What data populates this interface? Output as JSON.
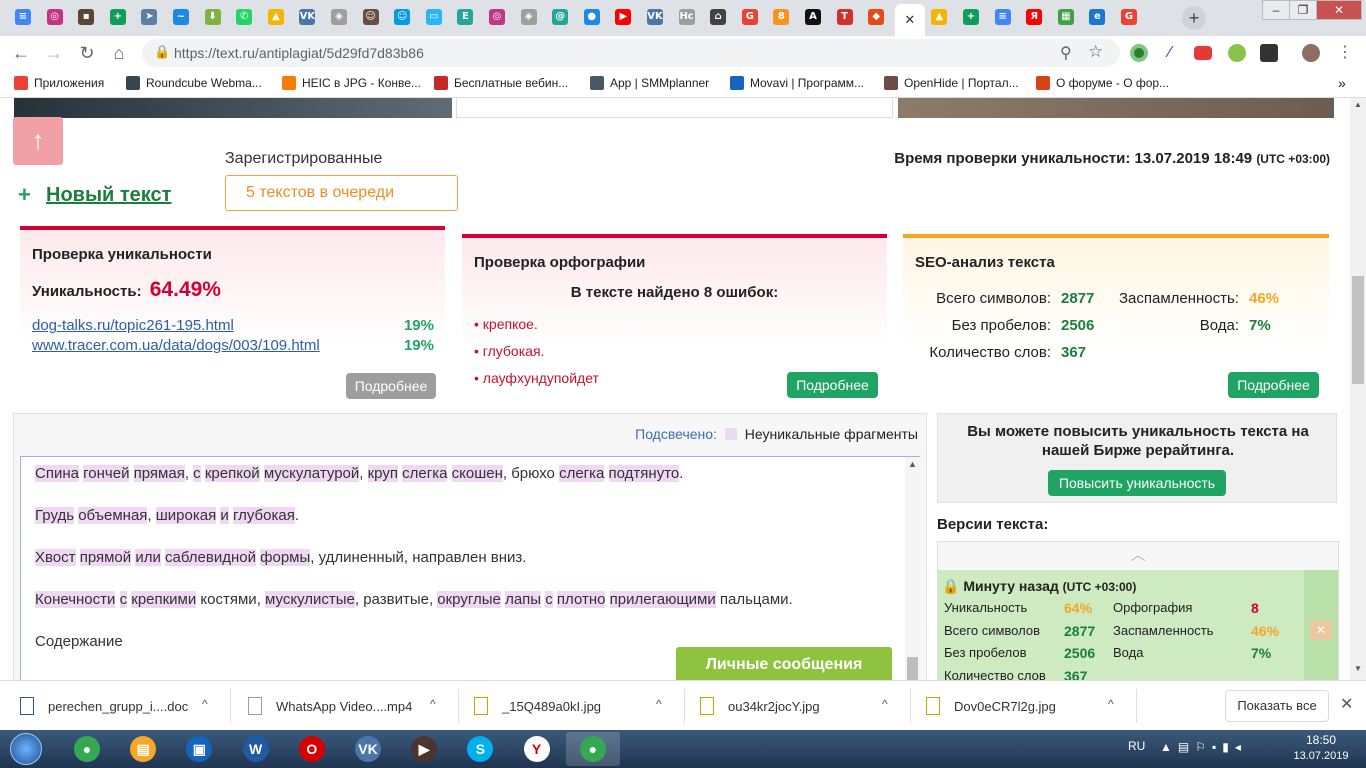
{
  "browser": {
    "tabs": [
      {
        "icon": "docs-icon",
        "color": "#4285f4",
        "glyph": "≡"
      },
      {
        "icon": "instagram-icon",
        "color": "#c13584",
        "glyph": "◎"
      },
      {
        "icon": "photo-icon",
        "color": "#5a4632",
        "glyph": "▪"
      },
      {
        "icon": "sheets-icon",
        "color": "#0f9d58",
        "glyph": "+"
      },
      {
        "icon": "telegram-icon",
        "color": "#5c7fa3",
        "glyph": "➤"
      },
      {
        "icon": "wave-icon",
        "color": "#1e88e5",
        "glyph": "~"
      },
      {
        "icon": "download-icon",
        "color": "#7cb342",
        "glyph": "⬇"
      },
      {
        "icon": "whatsapp-icon",
        "color": "#25d366",
        "glyph": "✆"
      },
      {
        "icon": "drive-icon",
        "color": "#f4b400",
        "glyph": "▲"
      },
      {
        "icon": "vk-icon",
        "color": "#4a76a8",
        "glyph": "VK"
      },
      {
        "icon": "shield-icon",
        "color": "#9e9e9e",
        "glyph": "◈"
      },
      {
        "icon": "avatar-icon",
        "color": "#6d4c41",
        "glyph": "☺"
      },
      {
        "icon": "chat-icon",
        "color": "#039be5",
        "glyph": "☺"
      },
      {
        "icon": "tv-icon",
        "color": "#29b6f6",
        "glyph": "▭"
      },
      {
        "icon": "text-icon",
        "color": "#26a69a",
        "glyph": "E"
      },
      {
        "icon": "instagram-icon",
        "color": "#c13584",
        "glyph": "◎"
      },
      {
        "icon": "shield-icon",
        "color": "#9e9e9e",
        "glyph": "◈"
      },
      {
        "icon": "spiral-icon",
        "color": "#26a69a",
        "glyph": "@"
      },
      {
        "icon": "drop-icon",
        "color": "#1e88e5",
        "glyph": "●"
      },
      {
        "icon": "youtube-icon",
        "color": "#ff0000",
        "glyph": "▶"
      },
      {
        "icon": "vk-icon",
        "color": "#4a76a8",
        "glyph": "VK"
      },
      {
        "icon": "hc-icon",
        "color": "#9e9e9e",
        "glyph": "Hc"
      },
      {
        "icon": "basket-icon",
        "color": "#424242",
        "glyph": "⌂"
      },
      {
        "icon": "google-icon",
        "color": "#ea4335",
        "glyph": "G"
      },
      {
        "icon": "ok-icon",
        "color": "#f7931e",
        "glyph": "8"
      },
      {
        "icon": "a-icon",
        "color": "#111111",
        "glyph": "A"
      },
      {
        "icon": "t-icon",
        "color": "#d32f2f",
        "glyph": "T"
      },
      {
        "icon": "fox-icon",
        "color": "#e64a19",
        "glyph": "◆"
      },
      {
        "icon": "close-icon",
        "color": "#ffffff",
        "glyph": "✕",
        "active": true
      },
      {
        "icon": "drive-icon",
        "color": "#f4b400",
        "glyph": "▲"
      },
      {
        "icon": "sheets-icon",
        "color": "#0f9d58",
        "glyph": "+"
      },
      {
        "icon": "docs-icon",
        "color": "#4285f4",
        "glyph": "≡"
      },
      {
        "icon": "yandex-icon",
        "color": "#ff0000",
        "glyph": "Я"
      },
      {
        "icon": "map-icon",
        "color": "#43a047",
        "glyph": "▦"
      },
      {
        "icon": "edge-icon",
        "color": "#1976d2",
        "glyph": "e"
      },
      {
        "icon": "google-icon",
        "color": "#ea4335",
        "glyph": "G"
      }
    ],
    "url": "https://text.ru/antiplagiat/5d29fd7d83b86",
    "bookmarks": [
      {
        "label": "Приложения",
        "color": "#ea4335"
      },
      {
        "label": "Roundcube Webma...",
        "color": "#37474f"
      },
      {
        "label": "HEIC в JPG - Конве...",
        "color": "#f57c00"
      },
      {
        "label": "Бесплатные вебин...",
        "color": "#c62828"
      },
      {
        "label": "App | SMMplanner",
        "color": "#455a64"
      },
      {
        "label": "Movavi | Программ...",
        "color": "#1565c0"
      },
      {
        "label": "OpenHide | Портал...",
        "color": "#6d4c41"
      },
      {
        "label": "О форуме - О фор...",
        "color": "#d84315"
      }
    ],
    "bookmarks_more": "»"
  },
  "page": {
    "scroll_up_glyph": "↑",
    "registered_label": "Зарегистрированные",
    "queue_label": "5 текстов в очереди",
    "new_text_icon": "+",
    "new_text_label": "Новый текст",
    "check_time_label": "Время проверки уникальности: 13.07.2019 18:49",
    "check_time_tz": "(UTC +03:00)",
    "uniqueness": {
      "title": "Проверка уникальности",
      "label": "Уникальность:",
      "value": "64.49%",
      "sources": [
        {
          "url": "dog-talks.ru/topic261-195.html",
          "percent": "19%"
        },
        {
          "url": "www.tracer.com.ua/data/dogs/003/109.html",
          "percent": "19%"
        }
      ],
      "more_label": "Подробнее",
      "accent": "#d50032"
    },
    "spelling": {
      "title": "Проверка орфографии",
      "subtitle": "В тексте найдено 8 ошибок:",
      "errors": [
        "крепкое.",
        "глубокая.",
        "лауфхундупойдет"
      ],
      "more_label": "Подробнее",
      "accent": "#d50032"
    },
    "seo": {
      "title": "SEO-анализ текста",
      "left": [
        {
          "label": "Всего символов:",
          "value": "2877"
        },
        {
          "label": "Без пробелов:",
          "value": "2506"
        },
        {
          "label": "Количество слов:",
          "value": "367"
        }
      ],
      "right": [
        {
          "label": "Заспамленность:",
          "value": "46%"
        },
        {
          "label": "Вода:",
          "value": "7%"
        }
      ],
      "more_label": "Подробнее",
      "accent": "#f5a623"
    },
    "highlight_label": "Подсвечено:",
    "highlight_legend": "Неуникальные фрагменты",
    "text_paragraphs": [
      [
        [
          "Спина",
          1
        ],
        [
          " ",
          0
        ],
        [
          "гончей",
          1
        ],
        [
          " ",
          0
        ],
        [
          "прямая",
          1
        ],
        [
          ", ",
          0
        ],
        [
          "с",
          1
        ],
        [
          " ",
          0
        ],
        [
          "крепкой",
          1
        ],
        [
          " ",
          0
        ],
        [
          "мускулатурой",
          1
        ],
        [
          ", ",
          0
        ],
        [
          "круп",
          1
        ],
        [
          " ",
          0
        ],
        [
          "слегка",
          1
        ],
        [
          " ",
          0
        ],
        [
          "скошен",
          1
        ],
        [
          ", брюхо ",
          0
        ],
        [
          "слегка",
          1
        ],
        [
          " ",
          0
        ],
        [
          "подтянуто",
          1
        ],
        [
          ".",
          0
        ]
      ],
      [
        [
          "Грудь",
          1
        ],
        [
          " ",
          0
        ],
        [
          "объемная",
          1
        ],
        [
          ", ",
          0
        ],
        [
          "широкая",
          1
        ],
        [
          " ",
          0
        ],
        [
          "и",
          1
        ],
        [
          " ",
          0
        ],
        [
          "глубокая",
          1
        ],
        [
          ".",
          0
        ]
      ],
      [
        [
          "Хвост",
          1
        ],
        [
          " ",
          0
        ],
        [
          "прямой",
          1
        ],
        [
          " ",
          0
        ],
        [
          "или",
          1
        ],
        [
          " ",
          0
        ],
        [
          "саблевидной",
          1
        ],
        [
          " ",
          0
        ],
        [
          "формы",
          1
        ],
        [
          ", удлиненный, направлен вниз.",
          0
        ]
      ],
      [
        [
          "Конечности",
          1
        ],
        [
          " ",
          0
        ],
        [
          "с",
          1
        ],
        [
          " ",
          0
        ],
        [
          "крепкими",
          1
        ],
        [
          " костями, ",
          0
        ],
        [
          "мускулистые",
          1
        ],
        [
          ", развитые, ",
          0
        ],
        [
          "округлые",
          1
        ],
        [
          " ",
          0
        ],
        [
          "лапы",
          1
        ],
        [
          " ",
          0
        ],
        [
          "с",
          1
        ],
        [
          " ",
          0
        ],
        [
          "плотно",
          1
        ],
        [
          " ",
          0
        ],
        [
          "прилегающими",
          1
        ],
        [
          " пальцами.",
          0
        ]
      ],
      [
        [
          "Содержание",
          0
        ]
      ]
    ],
    "messages_label": "Личные сообщения",
    "promo_text": "Вы можете повысить уникальность текста на нашей Бирже рерайтинга.",
    "promo_button": "Повысить уникальность",
    "versions_title": "Версии текста:",
    "version": {
      "time": "Минуту назад",
      "tz": "(UTC +03:00)",
      "rows": [
        {
          "l1": "Уникальность",
          "v1": "64%",
          "l2": "Орфография",
          "v2": "8"
        },
        {
          "l1": "Всего символов",
          "v1": "2877",
          "l2": "Заспамленность",
          "v2": "46%"
        },
        {
          "l1": "Без пробелов",
          "v1": "2506",
          "l2": "Вода",
          "v2": "7%"
        },
        {
          "l1": "Количество слов",
          "v1": "367",
          "l2": "",
          "v2": ""
        }
      ]
    }
  },
  "downloads": {
    "items": [
      {
        "name": "perechen_grupp_i....doc",
        "icon": "word-file-icon"
      },
      {
        "name": "WhatsApp Video....mp4",
        "icon": "video-file-icon"
      },
      {
        "name": "_15Q489a0kI.jpg",
        "icon": "image-file-icon"
      },
      {
        "name": "ou34kr2jocY.jpg",
        "icon": "image-file-icon"
      },
      {
        "name": "Dov0eCR7l2g.jpg",
        "icon": "image-file-icon"
      }
    ],
    "show_all": "Показать все",
    "chevron": "^"
  },
  "taskbar": {
    "apps": [
      {
        "icon": "chrome-icon",
        "color": "#34a853",
        "glyph": "●"
      },
      {
        "icon": "explorer-icon",
        "color": "#f9a825",
        "glyph": "▤"
      },
      {
        "icon": "save-icon",
        "color": "#1565c0",
        "glyph": "▣"
      },
      {
        "icon": "word-icon",
        "color": "#1e5aa8",
        "glyph": "W"
      },
      {
        "icon": "opera-icon",
        "color": "#d50000",
        "glyph": "O"
      },
      {
        "icon": "vk-icon",
        "color": "#4a76a8",
        "glyph": "VK"
      },
      {
        "icon": "video-icon",
        "color": "#4e342e",
        "glyph": "▶"
      },
      {
        "icon": "skype-icon",
        "color": "#00aff0",
        "glyph": "S"
      },
      {
        "icon": "yandex-browser-icon",
        "color": "#ffffff",
        "glyph": "Y"
      },
      {
        "icon": "chrome-icon",
        "color": "#34a853",
        "glyph": "●"
      }
    ],
    "lang": "RU",
    "time": "18:50",
    "date": "13.07.2019"
  }
}
